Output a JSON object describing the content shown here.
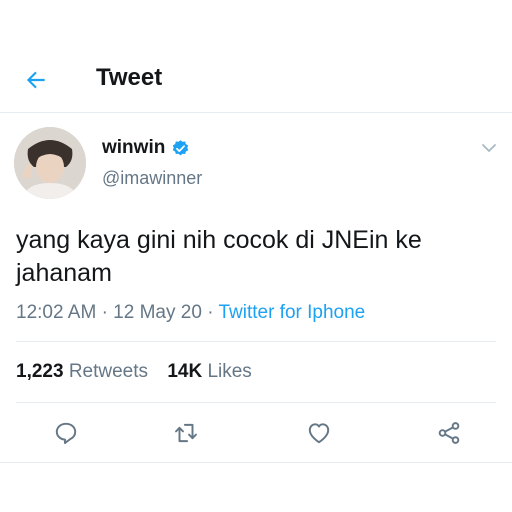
{
  "header": {
    "title": "Tweet",
    "back_icon": "arrow-left-icon"
  },
  "tweet": {
    "display_name": "winwin",
    "verified_icon": "verified-badge-icon",
    "handle": "@imawinner",
    "text": "yang kaya gini nih cocok di JNEin ke jahanam",
    "time": "12:02 AM",
    "date": "12 May 20",
    "separator": "·",
    "source": "Twitter for Iphone"
  },
  "stats": {
    "retweets_count": "1,223",
    "retweets_label": "Retweets",
    "likes_count": "14K",
    "likes_label": "Likes"
  },
  "actions": [
    "reply-icon",
    "retweet-icon",
    "like-icon",
    "share-icon"
  ],
  "colors": {
    "accent": "#1da1f2",
    "text_primary": "#14171a",
    "text_secondary": "#657786",
    "divider": "#e6ecf0"
  }
}
